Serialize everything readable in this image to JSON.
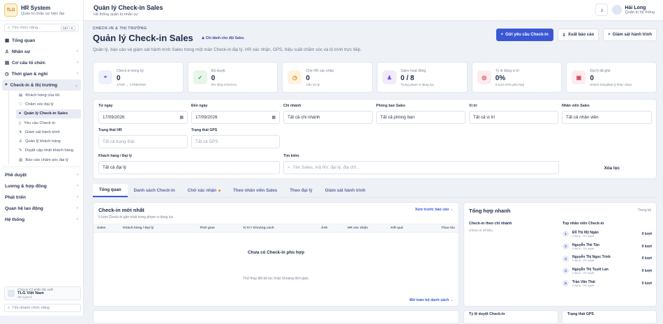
{
  "app": {
    "logo": "TLG",
    "name": "HR System",
    "tagline": "Quản trị nhân sự hiện đại"
  },
  "sidebar": {
    "search_placeholder": "Tìm chức năng...",
    "search_kbd": "Ctrl + K",
    "items": [
      {
        "label": "Tổng quan"
      },
      {
        "label": "Nhân sự"
      },
      {
        "label": "Cơ cấu tổ chức"
      },
      {
        "label": "Thời gian & nghỉ"
      },
      {
        "label": "Check-in & thị trường"
      }
    ],
    "sub_items": [
      {
        "label": "Khách hàng của tôi"
      },
      {
        "label": "Chăm sóc đại lý"
      },
      {
        "label": "Quản lý Check-in Sales"
      },
      {
        "label": "Yêu cầu Check-in"
      },
      {
        "label": "Giám sát hành trình"
      },
      {
        "label": "Quản lý khách hàng"
      },
      {
        "label": "Duyệt cập nhật khách hàng"
      },
      {
        "label": "Báo cáo chăm sóc đại lý"
      }
    ],
    "items2": [
      {
        "label": "Phê duyệt"
      },
      {
        "label": "Lương & hợp đồng"
      },
      {
        "label": "Phát triển"
      },
      {
        "label": "Quan hệ lao động"
      },
      {
        "label": "Hệ thống"
      }
    ],
    "company": {
      "line1": "Công ty Cổ phần tấn suất",
      "name": "TLG Việt Nam",
      "sys": "HR System"
    },
    "quick_search": "Tìm nhanh chức năng"
  },
  "topbar": {
    "title": "Quản lý Check-in Sales",
    "subtitle": "Hệ thống quản trị nhân sự",
    "user_name": "Hải Long",
    "user_role": "Quản trị hệ thống"
  },
  "page": {
    "kicker": "CHECK-IN & THỊ TRƯỜNG",
    "title": "Quản lý Check-in Sales",
    "pill": "Chỉ dành cho đội Sales",
    "desc": "Quản lý, báo cáo và giám sát hành trình Sales trong một màn Check-in đại lý. HR xác nhận, GPS, hiệu suất chăm sóc và lộ trình trực tiếp.",
    "btn_request": "Gửi yêu cầu Check-in",
    "btn_export": "Xuất báo cáo",
    "btn_monitor": "Giám sát hành trình"
  },
  "stats": [
    {
      "label": "Check-in trong kỳ",
      "value": "0",
      "sub": "17/09 → 17/09/2026",
      "icon": "pin-icon",
      "color": "#eef0fb",
      "fg": "#5a6ad6",
      "glyph": "⌖"
    },
    {
      "label": "Đã duyệt",
      "value": "0",
      "sub": "0% tổng Check-in",
      "icon": "check-icon",
      "color": "#e6f6ea",
      "fg": "#2f9a52",
      "glyph": "✓"
    },
    {
      "label": "Chờ HR xác nhận",
      "value": "0",
      "sub": "Cần xử lý",
      "icon": "clock-icon",
      "color": "#fff3e0",
      "fg": "#e08a1c",
      "glyph": "◷"
    },
    {
      "label": "Sales hoạt động",
      "value": "0 / 8",
      "sub": "Trong phạm vi đang lọc",
      "icon": "user-icon",
      "color": "#f1ebfb",
      "fg": "#7a4fd0",
      "glyph": "♟"
    },
    {
      "label": "Tỷ lệ đúng vị trí",
      "value": "0%",
      "sub": "0 lượt GPS phù hợp",
      "icon": "target-icon",
      "color": "#fdecef",
      "fg": "#d6455f",
      "glyph": "◎"
    },
    {
      "label": "Đại lý đã ghé",
      "value": "0",
      "sub": "Khách hàng/Đại lý khác nhau",
      "icon": "store-icon",
      "color": "#fdecef",
      "fg": "#d6455f",
      "glyph": "▣"
    }
  ],
  "filters": {
    "from_label": "Từ ngày",
    "from": "17/09/2026",
    "to_label": "Đến ngày",
    "to": "17/09/2026",
    "branch_label": "Chi nhánh",
    "branch": "Tất cả chi nhánh",
    "dept_label": "Phòng ban Sales",
    "dept": "Tất cả phòng ban",
    "pos_label": "Vị trí",
    "pos": "Tất cả vị trí",
    "staff_label": "Nhân viên Sales",
    "staff": "Tất cả nhân viên",
    "hr_label": "Trạng thái HR",
    "hr": "Tất cả trạng thái",
    "gps_label": "Trạng thái GPS",
    "gps": "Tất cả GPS",
    "cust_label": "Khách hàng / Đại lý",
    "cust": "Tất cả đại lý",
    "search_label": "Tìm kiếm",
    "search_ph": "Tên Sales, mã NV, đại lý, địa chỉ...",
    "clear": "Xóa lọc"
  },
  "tabs": [
    {
      "label": "Tổng quan"
    },
    {
      "label": "Danh sách Check-in"
    },
    {
      "label": "Chờ xác nhận"
    },
    {
      "label": "Theo nhân viên Sales"
    },
    {
      "label": "Theo đại lý"
    },
    {
      "label": "Giám sát hành trình"
    }
  ],
  "recent": {
    "title": "Check-in mới nhất",
    "sub": "5 lượt Check-in gần nhất trong phạm vi đang lọc.",
    "link": "Xem trước báo cáo →",
    "cols": [
      "Sales",
      "Khách hàng / Đại lý",
      "Thời gian",
      "Vị trí / Khoảng cách",
      "Ảnh",
      "HR xác nhận",
      "Kết quả",
      "Thao tác"
    ],
    "empty": "Chưa có Check-in phù hợp",
    "empty_sub": "Thử thay đổi bộ lọc hoặc khoảng thời gian.",
    "footer_link": "Mở toàn bộ danh sách →"
  },
  "summary": {
    "title": "Tổng hợp nhanh",
    "period": "Trong kỳ",
    "branch_title": "Check-in theo chi nhánh",
    "branch_empty": "Chưa có số liệu.",
    "top_title": "Top nhân viên Check-in",
    "people": [
      {
        "rank": "1",
        "name": "Đỗ Thị Mỹ Ngân",
        "sub": "0 đại lý · 0% duyệt",
        "value": "0 lượt"
      },
      {
        "rank": "2",
        "name": "Nguyễn Thế Tân",
        "sub": "0 đại lý · 0% duyệt",
        "value": "0 lượt"
      },
      {
        "rank": "3",
        "name": "Nguyễn Thị Ngọc Trinh",
        "sub": "0 đại lý · 0% duyệt",
        "value": "0 lượt"
      },
      {
        "rank": "4",
        "name": "Nguyễn Thị Tuyết Lan",
        "sub": "0 đại lý · 0% duyệt",
        "value": "0 lượt"
      },
      {
        "rank": "5",
        "name": "Trần Văn Thái",
        "sub": "0 đại lý · 0% duyệt",
        "value": "0 lượt"
      }
    ],
    "bottom_left": "Tỷ lệ duyệt Check-in",
    "bottom_right": "Trạng thái GPS"
  }
}
